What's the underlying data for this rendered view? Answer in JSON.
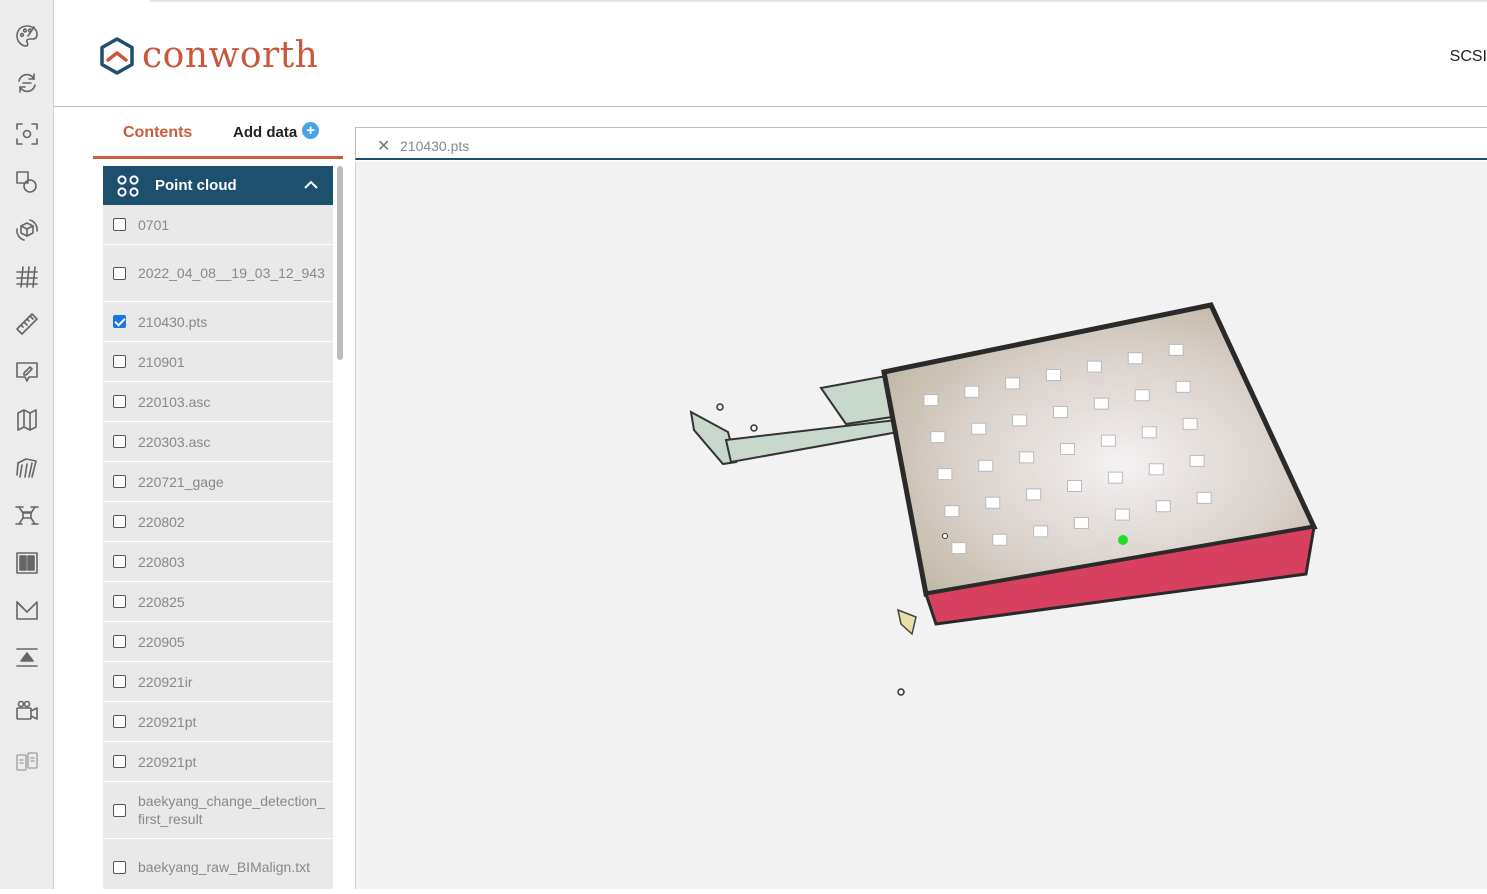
{
  "app": {
    "logo_text": "conworth",
    "user_label": "SCSI"
  },
  "toolbar": {
    "tools": [
      {
        "name": "palette-icon"
      },
      {
        "name": "sync-icon"
      },
      {
        "name": "focus-icon"
      },
      {
        "name": "shapes-icon"
      },
      {
        "name": "cube-rotate-icon"
      },
      {
        "name": "grid-3d-icon"
      },
      {
        "name": "ruler-icon"
      },
      {
        "name": "annotate-icon"
      },
      {
        "name": "map-icon"
      },
      {
        "name": "layers-icon"
      },
      {
        "name": "drone-icon"
      },
      {
        "name": "split-view-icon"
      },
      {
        "name": "section-icon"
      },
      {
        "name": "upload-icon"
      },
      {
        "name": "video-camera-icon"
      },
      {
        "name": "compare-icon"
      }
    ]
  },
  "sidebar": {
    "tab_contents": "Contents",
    "tab_add_data": "Add data",
    "add_symbol": "+",
    "panel_title": "Point cloud",
    "items": [
      {
        "label": "0701",
        "checked": false
      },
      {
        "label": "2022_04_08__19_03_12_943",
        "checked": false
      },
      {
        "label": "210430.pts",
        "checked": true
      },
      {
        "label": "210901",
        "checked": false
      },
      {
        "label": "220103.asc",
        "checked": false
      },
      {
        "label": "220303.asc",
        "checked": false
      },
      {
        "label": "220721_gage",
        "checked": false
      },
      {
        "label": "220802",
        "checked": false
      },
      {
        "label": "220803",
        "checked": false
      },
      {
        "label": "220825",
        "checked": false
      },
      {
        "label": "220905",
        "checked": false
      },
      {
        "label": "220921ir",
        "checked": false
      },
      {
        "label": "220921pt",
        "checked": false
      },
      {
        "label": "220921pt",
        "checked": false
      },
      {
        "label": "baekyang_change_detection_first_result",
        "checked": false
      },
      {
        "label": "baekyang_raw_BIMalign.txt",
        "checked": false
      }
    ]
  },
  "viewer": {
    "tab_close_symbol": "✕",
    "tab_name": "210430.pts",
    "colors": {
      "floor": "#d9d0c8",
      "wall": "#d8405f",
      "corridor": "#c9d8cc",
      "light": "#ffffff",
      "marker": "#22dd22"
    }
  }
}
